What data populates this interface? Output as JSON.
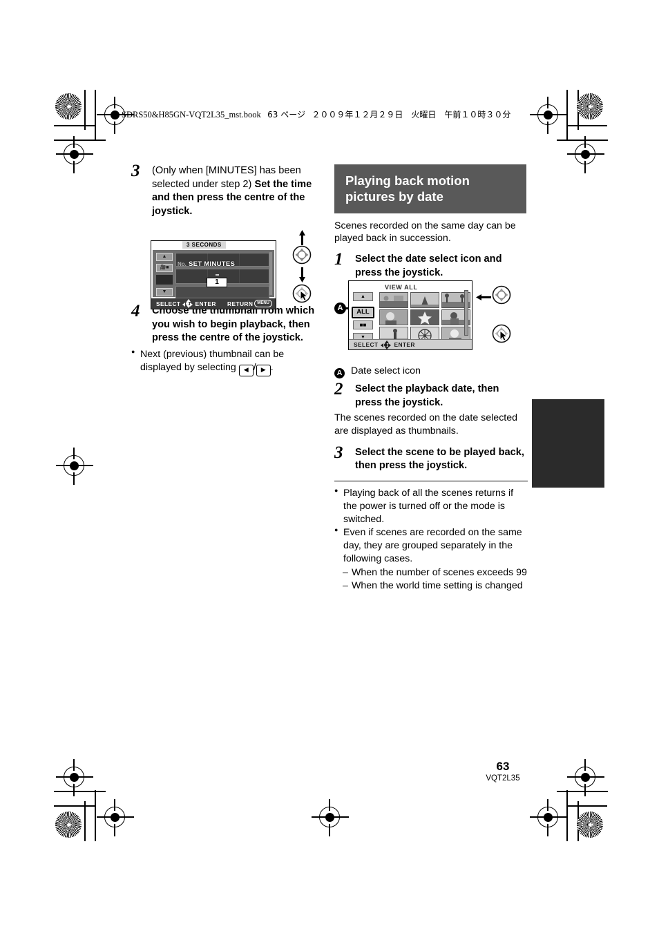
{
  "header": {
    "slug_file": "SDRS50&H85GN-VQT2L35_mst.book",
    "slug_page": "63 ページ",
    "slug_date": "２００９年１２月２９日　火曜日　午前１０時３０分"
  },
  "left_column": {
    "step3": {
      "number": "3",
      "lead": "(Only when [MINUTES] has been selected under step 2)",
      "bold": "Set the time and then press the centre of the joystick."
    },
    "step4": {
      "number": "4",
      "bold": "Choose the thumbnail from which you wish to begin playback, then press the centre of the joystick.",
      "bullet_pre": "Next (previous) thumbnail can be displayed by selecting ",
      "bullet_sep": "/",
      "bullet_post": "."
    },
    "lcd_set_minutes": {
      "title": "3 SECONDS",
      "overlay_label": "SET MINUTES",
      "no_label": "No.",
      "value": "1",
      "bar_select": "SELECT",
      "bar_enter": "ENTER",
      "bar_return": "RETURN",
      "bar_menu_key": "MENU"
    }
  },
  "right_column": {
    "section_title": "Playing back motion pictures by date",
    "intro": "Scenes recorded on the same day can be played back in succession.",
    "step1": {
      "number": "1",
      "bold": "Select the date select icon and press the joystick."
    },
    "legend": {
      "marker": "A",
      "text": "Date select icon"
    },
    "step2": {
      "number": "2",
      "bold": "Select the playback date, then press the joystick.",
      "note": "The scenes recorded on the date selected are displayed as thumbnails."
    },
    "step3": {
      "number": "3",
      "bold": "Select the scene to be played back, then press the joystick."
    },
    "notes": [
      "Playing back of all the scenes returns if the power is turned off or the mode is switched.",
      "Even if scenes are recorded on the same day, they are grouped separately in the following cases."
    ],
    "sub_notes": [
      "When the number of scenes exceeds 99",
      "When the world time setting is changed"
    ],
    "lcd_view_all": {
      "title": "VIEW ALL",
      "all_button": "ALL",
      "up_arrow": "▲",
      "down_arrow": "▼",
      "bar_select": "SELECT",
      "bar_enter": "ENTER"
    }
  },
  "footer": {
    "page_number": "63",
    "doc_code": "VQT2L35"
  },
  "colors": {
    "banner_bg": "#595959",
    "edge_tab": "#2b2b2b",
    "lcd1_bg": "#6e6e6e"
  }
}
